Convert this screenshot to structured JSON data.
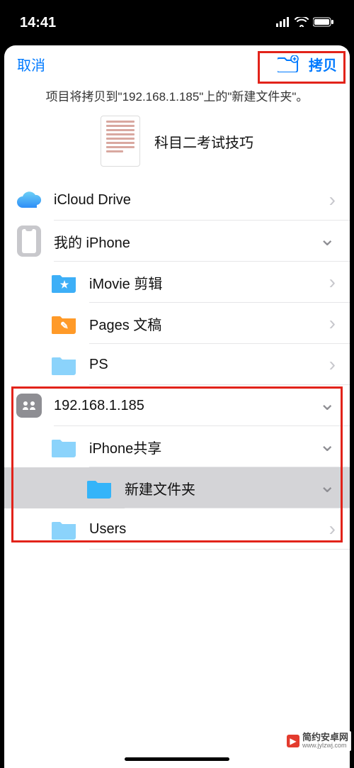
{
  "statusbar": {
    "time": "14:41"
  },
  "header": {
    "cancel": "取消",
    "copy": "拷贝"
  },
  "info": "项目将拷贝到\"192.168.1.185\"上的\"新建文件夹\"。",
  "copy_item": {
    "title": "科目二考试技巧"
  },
  "locations": {
    "icloud": "iCloud Drive",
    "my_iphone": "我的 iPhone",
    "imovie": "iMovie 剪辑",
    "pages": "Pages 文稿",
    "ps": "PS",
    "server": "192.168.1.185",
    "iphone_share": "iPhone共享",
    "new_folder": "新建文件夹",
    "users": "Users"
  },
  "watermark": {
    "title": "简约安卓网",
    "url": "www.jylzwj.com"
  }
}
